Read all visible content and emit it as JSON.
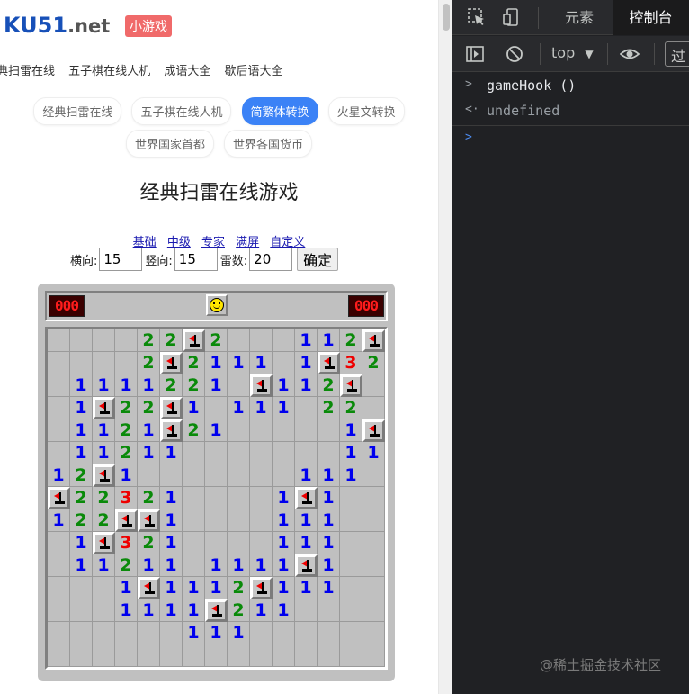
{
  "site": {
    "logo_main": "KU51",
    "logo_suffix": ".net",
    "badge": "小游戏",
    "topnav": [
      "典扫雷在线",
      "五子棋在线人机",
      "成语大全",
      "歇后语大全"
    ],
    "pills_row1": [
      "经典扫雷在线",
      "五子棋在线人机",
      "简繁体转换",
      "火星文转换"
    ],
    "pills_row2": [
      "世界国家首都",
      "世界各国货币"
    ],
    "active_pill": "简繁体转换",
    "title": "经典扫雷在线游戏",
    "levels": [
      "基础",
      "中级",
      "专家",
      "满屏",
      "自定义"
    ],
    "width_label": "横向:",
    "width_value": "15",
    "height_label": "竖向:",
    "height_value": "15",
    "mines_label": "雷数:",
    "mines_value": "20",
    "confirm_label": "确定"
  },
  "game": {
    "mines_counter": "000",
    "timer": "000",
    "rows": [
      "....22F2...112F",
      "....2F2111.1F32",
      ".1111221.F112F",
      ".1F22F1.111.22",
      ".1121F21.....1F",
      ".11211.......11",
      "12F1.......111.",
      "F22321....1F1..",
      "122FF1....111..",
      ".1F321....111..",
      ".11211.1111F1..",
      "...1F1112F111..",
      "...1111F211....",
      "......111......",
      "..............."
    ]
  },
  "devtools": {
    "tab_elements": "元素",
    "tab_console": "控制台",
    "context": "top",
    "filter_placeholder": "过",
    "input_command": "gameHook ()",
    "output_value": "undefined"
  },
  "watermark": "@稀土掘金技术社区"
}
